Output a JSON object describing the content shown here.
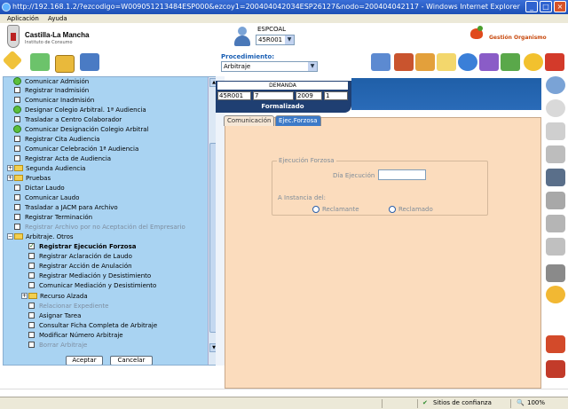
{
  "window": {
    "title": "http://192.168.1.2/?ezcodigo=W009051213484ESP000&ezcoy1=200404042034ESP26127&nodo=200404042117 - Windows Internet Explorer"
  },
  "menubar": [
    "Aplicación",
    "Ayuda"
  ],
  "header": {
    "brand": "Castilla-La Mancha",
    "brand_sub": "Instituto de Consumo",
    "user_label": "ESPCOAL",
    "user_select_value": "45R001",
    "procedimiento_label": "Procedimiento:",
    "procedimiento_value": "Arbitraje",
    "gestion_label": "Gestión Organismo"
  },
  "tree": {
    "items": [
      {
        "label": "Comunicar Admisión",
        "kind": "green"
      },
      {
        "label": "Registrar Inadmisión",
        "kind": "checkbox"
      },
      {
        "label": "Comunicar Inadmisión",
        "kind": "checkbox"
      },
      {
        "label": "Designar Colegio Arbitral. 1ª Audiencia",
        "kind": "green"
      },
      {
        "label": "Trasladar a Centro Colaborador",
        "kind": "checkbox"
      },
      {
        "label": "Comunicar Designación Colegio Arbitral",
        "kind": "green"
      },
      {
        "label": "Registrar Cita Audiencia",
        "kind": "checkbox"
      },
      {
        "label": "Comunicar Celebración 1ª Audiencia",
        "kind": "checkbox"
      },
      {
        "label": "Registrar Acta de Audiencia",
        "kind": "checkbox"
      },
      {
        "label": "Segunda Audiencia",
        "kind": "folder"
      },
      {
        "label": "Pruebas",
        "kind": "folder"
      },
      {
        "label": "Dictar Laudo",
        "kind": "checkbox"
      },
      {
        "label": "Comunicar Laudo",
        "kind": "checkbox"
      },
      {
        "label": "Trasladar a JACM para Archivo",
        "kind": "checkbox"
      },
      {
        "label": "Registrar Terminación",
        "kind": "checkbox"
      },
      {
        "label": "Registrar Archivo por no Aceptación del Empresario",
        "kind": "disabled"
      },
      {
        "label": "Arbitraje. Otros",
        "kind": "folder-open"
      },
      {
        "label": "Registrar Ejecución Forzosa",
        "kind": "checked"
      },
      {
        "label": "Registrar Aclaración de Laudo",
        "kind": "sub-checkbox"
      },
      {
        "label": "Registrar Acción de Anulación",
        "kind": "sub-checkbox"
      },
      {
        "label": "Registrar Mediación y Desistimiento",
        "kind": "sub-checkbox"
      },
      {
        "label": "Comunicar Mediación y Desistimiento",
        "kind": "sub-checkbox"
      },
      {
        "label": "Recurso Alzada",
        "kind": "sub-folder"
      },
      {
        "label": "Relacionar Expediente",
        "kind": "disabled"
      },
      {
        "label": "Asignar Tarea",
        "kind": "checkbox"
      },
      {
        "label": "Consultar Ficha Completa de Arbitraje",
        "kind": "checkbox"
      },
      {
        "label": "Modificar Número Arbitraje",
        "kind": "checkbox"
      },
      {
        "label": "Borrar Arbitraje",
        "kind": "disabled"
      }
    ],
    "accept_label": "Aceptar",
    "cancel_label": "Cancelar"
  },
  "demanda": {
    "title": "DEMANDA",
    "cells": [
      "45R001",
      "7",
      "2009",
      "1"
    ],
    "status": "Formalizado"
  },
  "tabs": [
    {
      "label": "Comunicación",
      "active": false
    },
    {
      "label": "Ejec.Forzosa",
      "active": true
    }
  ],
  "form": {
    "legend": "Ejecución Forzosa",
    "dia_label": "Día Ejecución",
    "dia_value": "",
    "instancia_label": "A Instancia del:",
    "radio1": "Reclamante",
    "radio2": "Reclamado"
  },
  "statusbar": {
    "zone": "Sitios de confianza",
    "zoom": "100%"
  },
  "colors": {
    "tree_bg": "#a9d3f2",
    "panel_bg": "#fbdcbd",
    "header_blue": "#1f3f72",
    "tab_active": "#3c7ac8"
  }
}
